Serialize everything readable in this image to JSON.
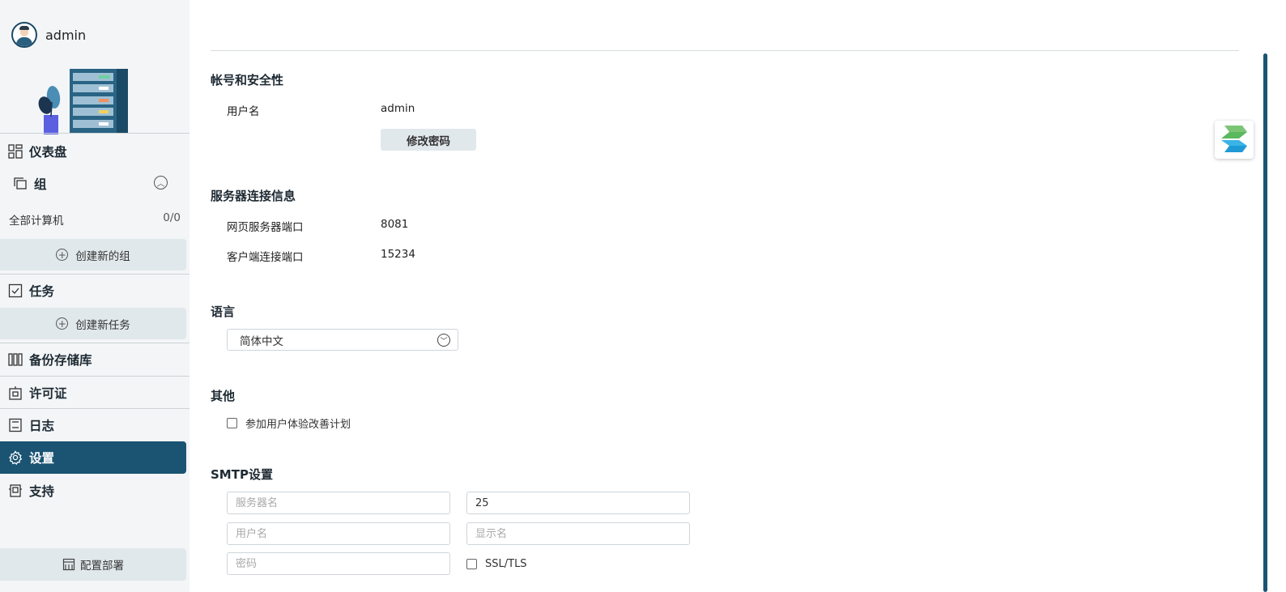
{
  "user": {
    "name": "admin"
  },
  "nav": {
    "dashboard": "仪表盘",
    "group": "组",
    "all_computers": "全部计算机",
    "all_computers_count": "0/0",
    "create_group": "创建新的组",
    "tasks": "任务",
    "create_task": "创建新任务",
    "backup_repo": "备份存储库",
    "license": "许可证",
    "logs": "日志",
    "settings": "设置",
    "support": "支持",
    "deploy": "配置部署"
  },
  "account": {
    "title": "帐号和安全性",
    "username_label": "用户名",
    "username_value": "admin",
    "change_password": "修改密码"
  },
  "server": {
    "title": "服务器连接信息",
    "web_port_label": "网页服务器端口",
    "web_port_value": "8081",
    "client_port_label": "客户端连接端口",
    "client_port_value": "15234"
  },
  "language": {
    "title": "语言",
    "selected": "简体中文"
  },
  "other": {
    "title": "其他",
    "ux_program": "参加用户体验改善计划"
  },
  "smtp": {
    "title": "SMTP设置",
    "server_placeholder": "服务器名",
    "port_value": "25",
    "username_placeholder": "用户名",
    "display_name_placeholder": "显示名",
    "password_placeholder": "密码",
    "ssl_label": "SSL/TLS"
  },
  "colors": {
    "accent": "#1b5473",
    "sidebar_bg": "#f3f5f7",
    "button_bg": "#e1e8ec"
  }
}
